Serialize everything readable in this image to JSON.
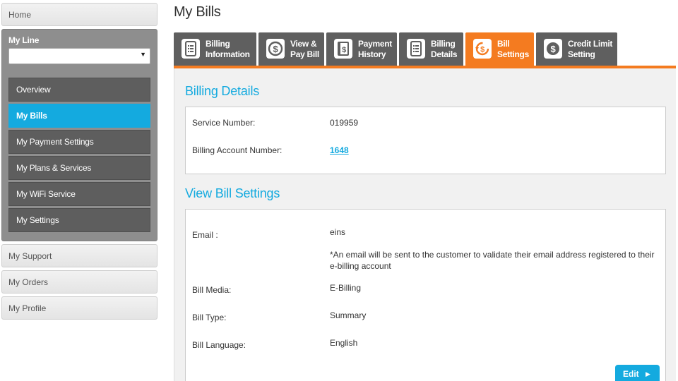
{
  "sidebar": {
    "home": "Home",
    "my_line": {
      "title": "My Line",
      "select_value": "",
      "items": [
        {
          "label": "Overview",
          "active": false
        },
        {
          "label": "My Bills",
          "active": true
        },
        {
          "label": "My Payment Settings",
          "active": false
        },
        {
          "label": "My Plans & Services",
          "active": false
        },
        {
          "label": "My WiFi Service",
          "active": false
        },
        {
          "label": "My Settings",
          "active": false
        }
      ]
    },
    "support": "My Support",
    "orders": "My Orders",
    "profile": "My Profile"
  },
  "page": {
    "title": "My Bills"
  },
  "tabs": [
    {
      "line1": "Billing",
      "line2": "Information",
      "icon": "document-list-icon",
      "active": false
    },
    {
      "line1": "View &",
      "line2": "Pay Bill",
      "icon": "dollar-circle-icon",
      "active": false
    },
    {
      "line1": "Payment",
      "line2": "History",
      "icon": "ledger-dollar-icon",
      "active": false
    },
    {
      "line1": "Billing",
      "line2": "Details",
      "icon": "document-list-icon",
      "active": false
    },
    {
      "line1": "Bill",
      "line2": "Settings",
      "icon": "dollar-refresh-icon",
      "active": true
    },
    {
      "line1": "Credit Limit",
      "line2": "Setting",
      "icon": "dollar-badge-icon",
      "active": false
    }
  ],
  "billing_details": {
    "title": "Billing Details",
    "service_number_label": "Service Number:",
    "service_number": "019959",
    "account_number_label": "Billing Account Number:",
    "account_number": "1648"
  },
  "bill_settings": {
    "title": "View Bill Settings",
    "email_label": "Email :",
    "email_value": "eins",
    "email_note": "*An email will be sent to the customer to validate their email address registered to their e-billing account",
    "media_label": "Bill Media:",
    "media_value": "E-Billing",
    "type_label": "Bill Type:",
    "type_value": "Summary",
    "language_label": "Bill Language:",
    "language_value": "English",
    "edit_label": "Edit"
  },
  "colors": {
    "accent_blue": "#14aadf",
    "accent_orange": "#f47b20",
    "tab_dark": "#5f5f5f"
  }
}
